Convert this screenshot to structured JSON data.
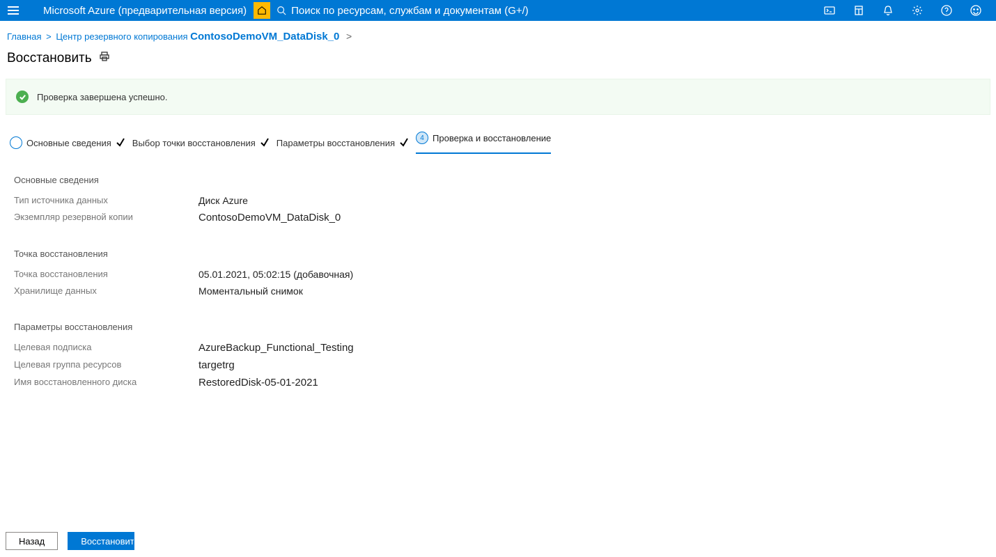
{
  "topbar": {
    "brand": "Microsoft Azure (предварительная версия)",
    "search_placeholder": "Поиск по ресурсам, службам и документам (G+/)"
  },
  "breadcrumb": {
    "home": "Главная",
    "backup_center": "Центр резервного копирования",
    "current": "ContosoDemoVM_DataDisk_0"
  },
  "page": {
    "title": "Восстановить"
  },
  "banner": {
    "message": "Проверка завершена успешно."
  },
  "steps": {
    "s1": "Основные сведения",
    "s2": "Выбор точки восстановления",
    "s3": "Параметры восстановления",
    "s4": "Проверка и восстановление",
    "num4": "4"
  },
  "sections": {
    "basics": {
      "title": "Основные сведения",
      "datasource_type_label": "Тип источника данных",
      "datasource_type_value": "Диск Azure",
      "backup_instance_label": "Экземпляр резервной копии",
      "backup_instance_value": "ContosoDemoVM_DataDisk_0"
    },
    "restore_point": {
      "title": "Точка восстановления",
      "restore_point_label": "Точка восстановления",
      "restore_point_value": "05.01.2021, 05:02:15 (добавочная)",
      "datastore_label": "Хранилище данных",
      "datastore_value": "Моментальный снимок"
    },
    "restore_params": {
      "title": "Параметры восстановления",
      "target_sub_label": "Целевая подписка",
      "target_sub_value": "AzureBackup_Functional_Testing",
      "target_rg_label": "Целевая группа ресурсов",
      "target_rg_value": "targetrg",
      "restored_disk_label": "Имя восстановленного диска",
      "restored_disk_value": "RestoredDisk-05-01-2021"
    }
  },
  "footer": {
    "back": "Назад",
    "restore": "Восстановить"
  }
}
